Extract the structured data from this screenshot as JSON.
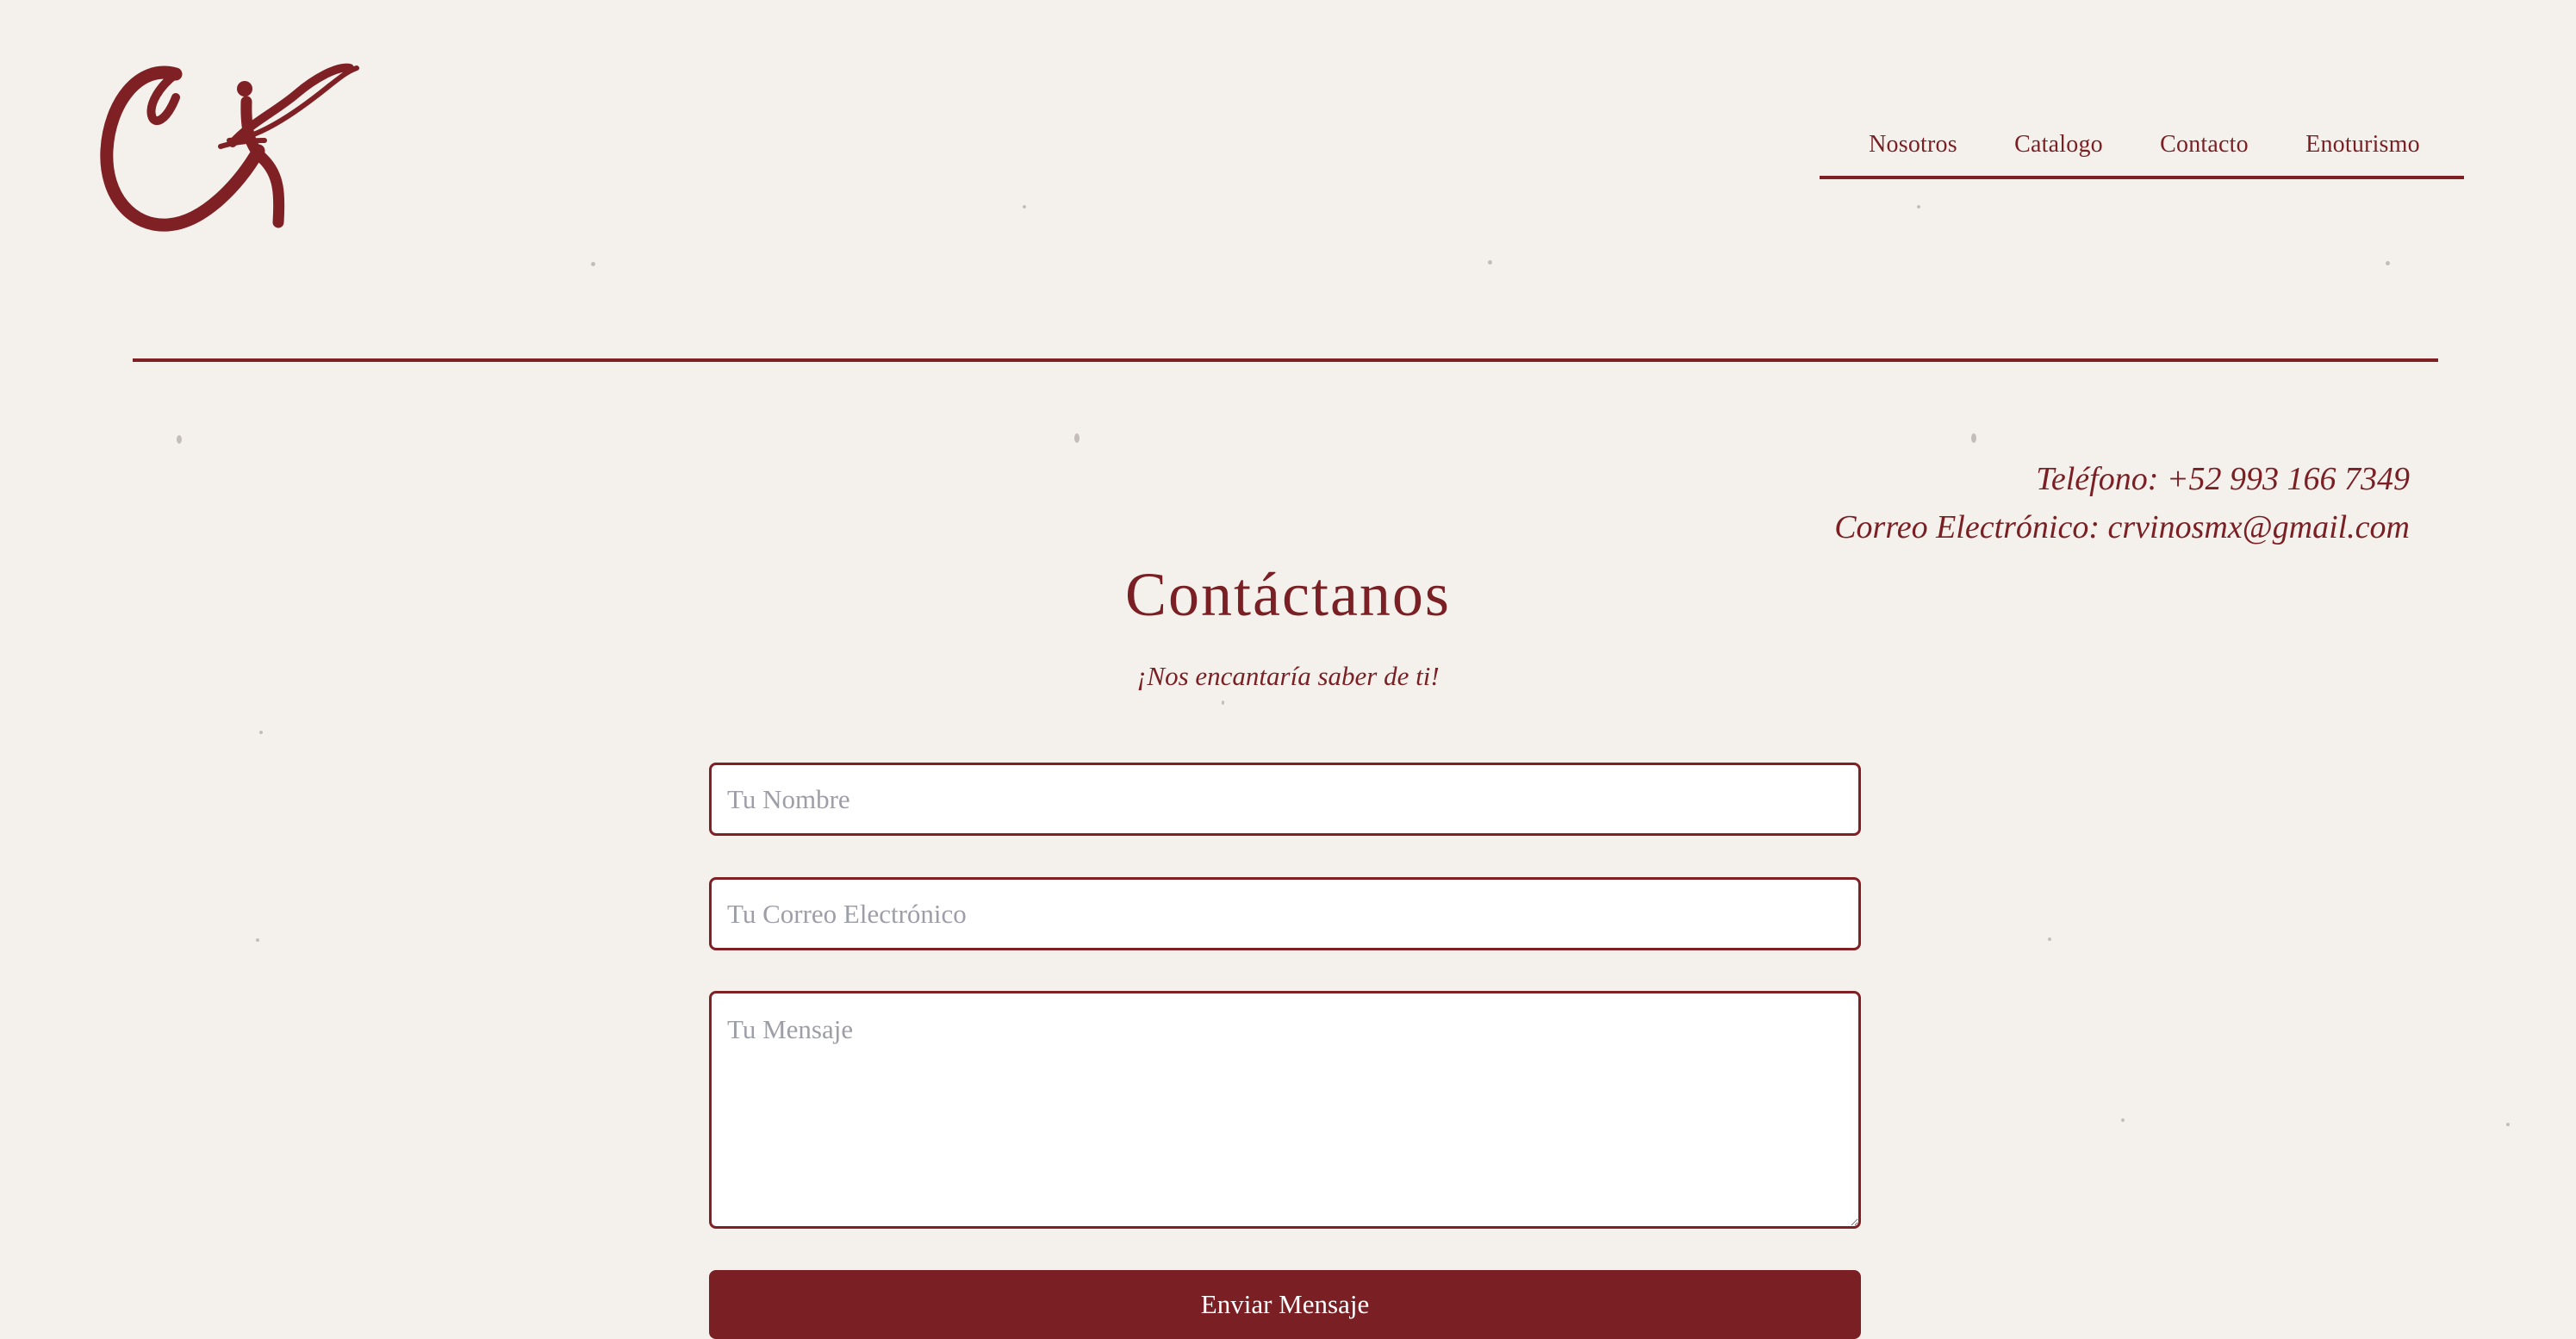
{
  "brand": {
    "logo_text": "CR"
  },
  "nav": {
    "items": [
      {
        "label": "Nosotros"
      },
      {
        "label": "Catalogo"
      },
      {
        "label": "Contacto"
      },
      {
        "label": "Enoturismo"
      }
    ]
  },
  "contact": {
    "phone": "Teléfono: +52 993 166 7349",
    "email": "Correo Electrónico: crvinosmx@gmail.com"
  },
  "section": {
    "title": "Contáctanos",
    "subtitle": "¡Nos encantaría saber de ti!"
  },
  "form": {
    "name_placeholder": "Tu Nombre",
    "email_placeholder": "Tu Correo Electrónico",
    "message_placeholder": "Tu Mensaje",
    "submit_label": "Enviar Mensaje"
  },
  "colors": {
    "background": "#f4f1ec",
    "accent": "#7a1f24",
    "field_background": "#ffffff",
    "placeholder": "#9d9ea8"
  }
}
